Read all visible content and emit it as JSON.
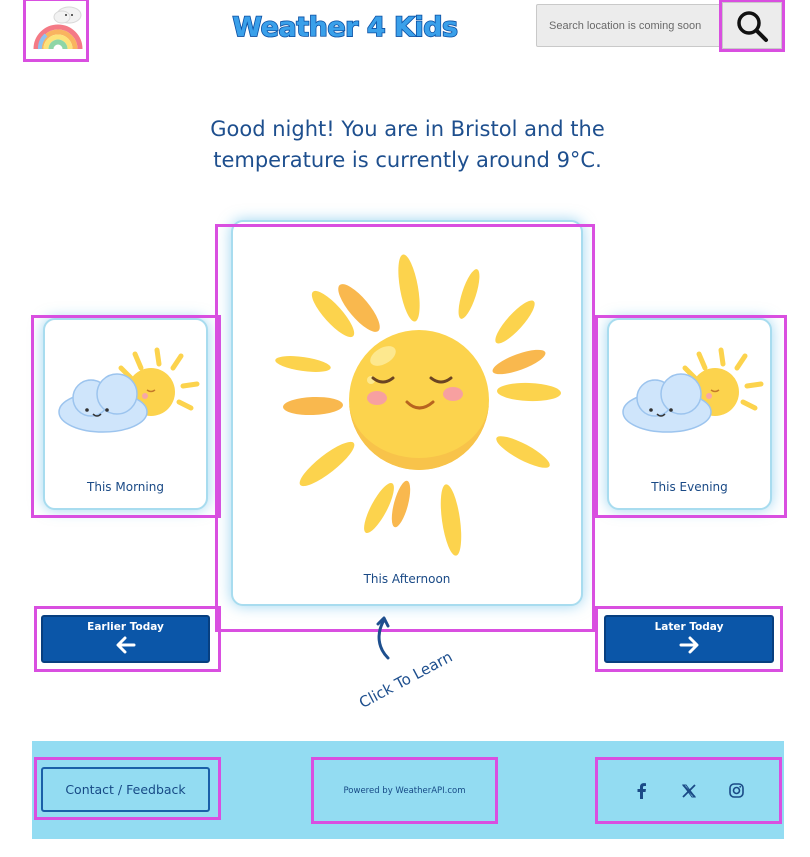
{
  "header": {
    "logo_icon": "rainbow-cloud-icon",
    "site_title": "Weather 4 Kids",
    "search": {
      "placeholder": "Search location is coming soon",
      "value": "",
      "button_icon": "search-icon"
    }
  },
  "greeting": {
    "line1": "Good night! You are in Bristol and the",
    "line2": "temperature is currently around 9°C."
  },
  "cards": {
    "morning": {
      "label": "This Morning",
      "icon": "sun-behind-cloud-icon"
    },
    "afternoon": {
      "label": "This Afternoon",
      "icon": "sun-icon"
    },
    "evening": {
      "label": "This Evening",
      "icon": "sun-behind-cloud-icon"
    }
  },
  "nav": {
    "earlier": {
      "label": "Earlier Today",
      "icon": "arrow-left-icon"
    },
    "later": {
      "label": "Later Today",
      "icon": "arrow-right-icon"
    }
  },
  "hint": {
    "text": "Click To Learn",
    "icon": "curved-arrow-icon"
  },
  "footer": {
    "contact_label": "Contact / Feedback",
    "powered_by": "Powered by WeatherAPI.com",
    "social": [
      "facebook-icon",
      "x-icon",
      "instagram-icon"
    ]
  },
  "colors": {
    "title_fill": "#3aa0ea",
    "title_stroke": "#0b4ea2",
    "text": "#1e4f8e",
    "button": "#0b56a8",
    "footer_bg": "#93dcf2",
    "card_glow": "#a8dcef",
    "highlight": "#d94fe0"
  }
}
